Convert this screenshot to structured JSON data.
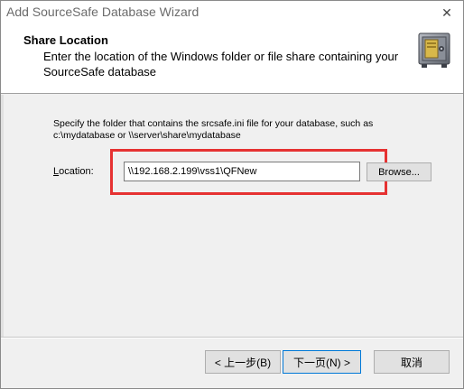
{
  "window": {
    "title": "Add SourceSafe Database Wizard",
    "close_glyph": "✕"
  },
  "header": {
    "title": "Share Location",
    "description": "Enter the location of the Windows folder or file share containing your SourceSafe database",
    "icon": "safe-icon"
  },
  "body": {
    "instruction": "Specify the folder that contains the srcsafe.ini file for your database, such as c:\\mydatabase or \\\\server\\share\\mydatabase",
    "location_label_mnemonic": "L",
    "location_label_rest": "ocation:",
    "location_value": "\\\\192.168.2.199\\vss1\\QFNew",
    "browse_label": "Browse..."
  },
  "footer": {
    "back_label": "< 上一步(B)",
    "next_label": "下一页(N) >",
    "cancel_label": "取消"
  },
  "colors": {
    "highlight": "#e63232",
    "default_button_border": "#0078d7"
  }
}
